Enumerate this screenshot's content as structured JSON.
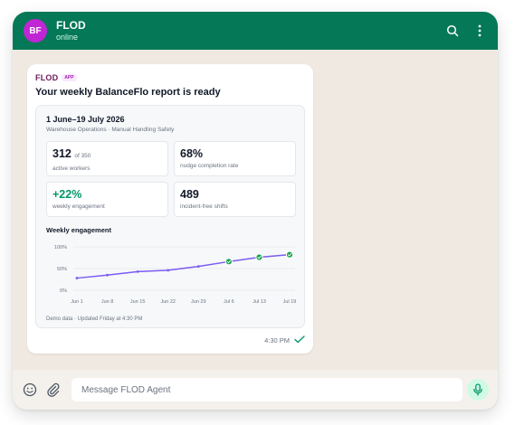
{
  "header": {
    "avatar_initials": "BF",
    "title": "FLOD",
    "status": "online",
    "icons": [
      "search-icon",
      "more-vertical-icon"
    ]
  },
  "message": {
    "sender": "FLOD",
    "badge": "APP",
    "title": "Your weekly BalanceFlo report is ready",
    "report": {
      "period": "1 June–19 July 2026",
      "subtitle": "Warehouse Operations · Manual Handling Safety",
      "stats": [
        {
          "value": "312",
          "suffix": "of 350",
          "label": "active workers"
        },
        {
          "value": "68%",
          "suffix": "",
          "label": "nudge completion rate"
        },
        {
          "value": "+22%",
          "suffix": "",
          "label": "weekly engagement"
        },
        {
          "value": "489",
          "suffix": "",
          "label": "incident-free shifts"
        }
      ],
      "chart_title": "Weekly engagement",
      "footnote": "Demo data · Updated Friday at 4:30 PM"
    },
    "time": "4:30 PM",
    "status_icon": "double-check-icon"
  },
  "composer": {
    "placeholder": "Message FLOD Agent",
    "icons": [
      "emoji-icon",
      "paperclip-icon",
      "microphone-icon"
    ]
  },
  "colors": {
    "header": "#047857",
    "chat_background": "#efe9e1",
    "avatar": "#c026d3",
    "line": "#7c5cf0",
    "milestone": "#16a34a",
    "positive": "#059669"
  },
  "chart_data": {
    "type": "line",
    "title": "Weekly engagement",
    "x": [
      "Jun 1",
      "Jun 8",
      "Jun 15",
      "Jun 22",
      "Jun 29",
      "Jul 6",
      "Jul 13"
    ],
    "tick_labels_x": [
      "Jun 1",
      "Jun 8",
      "Jun 15",
      "Jun 22",
      "Jun 29",
      "Jul 6",
      "Jul 13",
      "Jul 19"
    ],
    "series": [
      {
        "values": [
          28,
          35,
          43,
          46,
          55,
          66,
          76,
          82
        ]
      }
    ],
    "milestones": [
      5,
      6,
      7
    ],
    "y_ticks": [
      "100%",
      "50%",
      "0%"
    ],
    "ylim": [
      0,
      100
    ],
    "grid": true,
    "xlabel": "",
    "ylabel": ""
  }
}
